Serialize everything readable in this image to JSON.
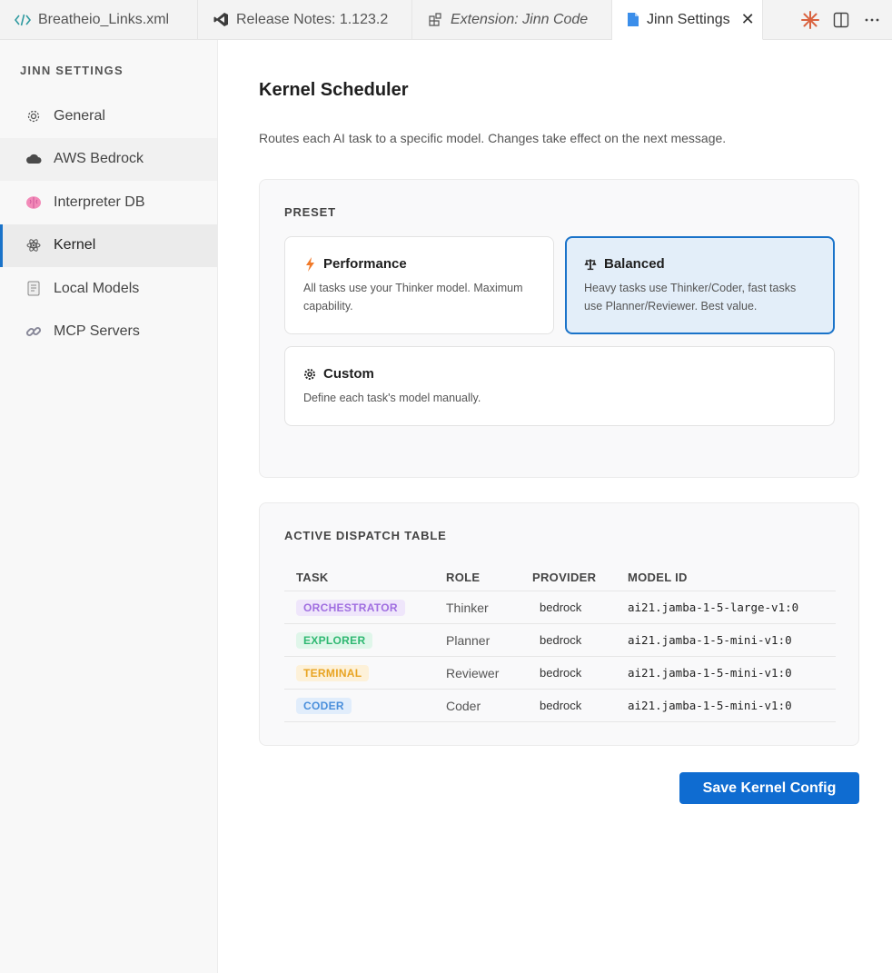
{
  "tabs": [
    {
      "label": "Breatheio_Links.xml",
      "icon": "code-file-icon",
      "italic": false,
      "active": false
    },
    {
      "label": "Release Notes: 1.123.2",
      "icon": "vscode-logo-icon",
      "italic": false,
      "active": false
    },
    {
      "label": "Extension: Jinn Code",
      "icon": "extension-icon",
      "italic": true,
      "active": false
    },
    {
      "label": "Jinn Settings",
      "icon": "file-icon",
      "italic": false,
      "active": true
    }
  ],
  "tab_close_symbol": "✕",
  "tab_actions": [
    "spark-icon",
    "split-editor-icon",
    "more-actions-icon"
  ],
  "sidebar": {
    "title": "JINN SETTINGS",
    "items": [
      {
        "label": "General",
        "icon": "gear-icon"
      },
      {
        "label": "AWS Bedrock",
        "icon": "cloud-icon"
      },
      {
        "label": "Interpreter DB",
        "icon": "brain-icon"
      },
      {
        "label": "Kernel",
        "icon": "atom-icon"
      },
      {
        "label": "Local Models",
        "icon": "document-icon"
      },
      {
        "label": "MCP Servers",
        "icon": "link-icon"
      }
    ],
    "active": "Kernel"
  },
  "main": {
    "title": "Kernel Scheduler",
    "description": "Routes each AI task to a specific model. Changes take effect on the next message.",
    "preset": {
      "title": "PRESET",
      "options": [
        {
          "name": "Performance",
          "icon": "lightning-icon",
          "description": "All tasks use your Thinker model. Maximum capability.",
          "selected": false
        },
        {
          "name": "Balanced",
          "icon": "scales-icon",
          "description": "Heavy tasks use Thinker/Coder, fast tasks use Planner/Reviewer. Best value.",
          "selected": true
        },
        {
          "name": "Custom",
          "icon": "gear-icon",
          "description": "Define each task's model manually.",
          "selected": false
        }
      ]
    },
    "dispatch": {
      "title": "ACTIVE DISPATCH TABLE",
      "columns": [
        "TASK",
        "ROLE",
        "PROVIDER",
        "MODEL ID"
      ],
      "rows": [
        {
          "task": "ORCHESTRATOR",
          "role": "Thinker",
          "provider": "bedrock",
          "model": "ai21.jamba-1-5-large-v1:0"
        },
        {
          "task": "EXPLORER",
          "role": "Planner",
          "provider": "bedrock",
          "model": "ai21.jamba-1-5-mini-v1:0"
        },
        {
          "task": "TERMINAL",
          "role": "Reviewer",
          "provider": "bedrock",
          "model": "ai21.jamba-1-5-mini-v1:0"
        },
        {
          "task": "CODER",
          "role": "Coder",
          "provider": "bedrock",
          "model": "ai21.jamba-1-5-mini-v1:0"
        }
      ]
    },
    "save_label": "Save Kernel Config"
  },
  "colors": {
    "accent": "#1a73c9",
    "save_button": "#0f6cd1",
    "badge_orchestrator": {
      "fg": "#a06ee0",
      "bg": "#efe6fb"
    },
    "badge_explorer": {
      "fg": "#2fb872",
      "bg": "#e0f6ea"
    },
    "badge_terminal": {
      "fg": "#e8a422",
      "bg": "#fdf1d9"
    },
    "badge_coder": {
      "fg": "#4a8fdb",
      "bg": "#e1edfb"
    }
  }
}
